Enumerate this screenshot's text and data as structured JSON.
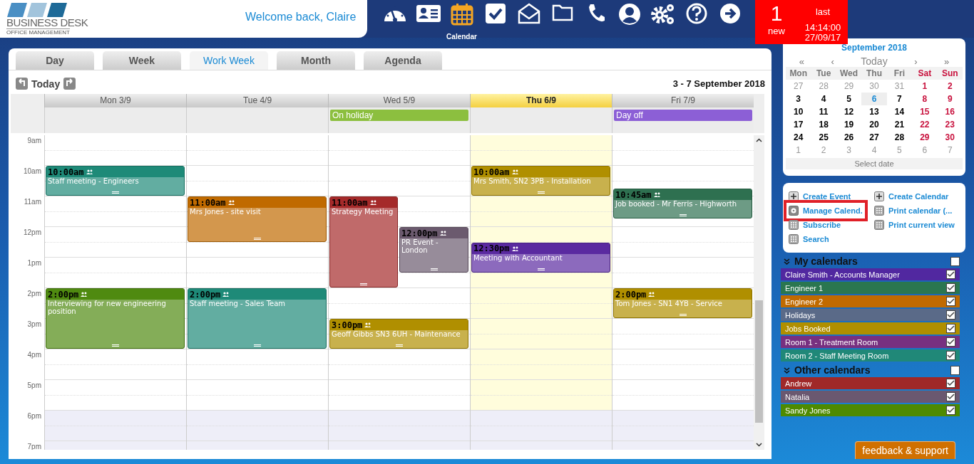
{
  "header": {
    "logo_title": "BUSINESS DESK",
    "logo_subtitle": "OFFICE MANAGEMENT",
    "welcome": "Welcome back, Claire"
  },
  "nav": [
    {
      "kind": "dashboard",
      "selected": false
    },
    {
      "kind": "contacts",
      "selected": false
    },
    {
      "kind": "calendar",
      "label": "Calendar",
      "selected": true
    },
    {
      "kind": "tasks",
      "selected": false
    },
    {
      "kind": "mail",
      "selected": false
    },
    {
      "kind": "folder",
      "selected": false
    },
    {
      "kind": "phone",
      "selected": false
    },
    {
      "kind": "user",
      "selected": false
    },
    {
      "kind": "settings",
      "selected": false
    },
    {
      "kind": "help",
      "selected": false
    },
    {
      "kind": "logout",
      "selected": false
    }
  ],
  "notification": {
    "count": "1",
    "count_label": "new",
    "last_label": "last",
    "time": "14:14:00",
    "date": "27/09/17"
  },
  "tabs": [
    {
      "label": "Day",
      "selected": false
    },
    {
      "label": "Week",
      "selected": false
    },
    {
      "label": "Work Week",
      "selected": true
    },
    {
      "label": "Month",
      "selected": false
    },
    {
      "label": "Agenda",
      "selected": false
    }
  ],
  "toolbar": {
    "today": "Today",
    "range": "3 - 7 September 2018"
  },
  "hours": [
    "9am",
    "10am",
    "11am",
    "12pm",
    "1pm",
    "2pm",
    "3pm",
    "4pm",
    "5pm",
    "6pm",
    "7pm"
  ],
  "days": [
    {
      "label": "Mon 3/9",
      "selected": false,
      "events": [
        {
          "time": "10:00am",
          "title": "Staff meeting - Engineers",
          "color": "#1e8a78",
          "kind": "hour"
        },
        {
          "time": "2:00pm",
          "title": "Interviewing for new engineering position",
          "color": "#4f8a10",
          "kind": "twohours"
        }
      ]
    },
    {
      "label": "Tue 4/9",
      "selected": false,
      "events": [
        {
          "time": "11:00am",
          "title": "Mrs Jones - site visit",
          "color": "#c06a00",
          "kind": "ninety"
        },
        {
          "time": "2:00pm",
          "title": "Staff meeting - Sales Team",
          "color": "#1e8a78",
          "kind": "twohours"
        }
      ]
    },
    {
      "label": "Wed 5/9",
      "selected": false,
      "all_day": [
        {
          "title": "On holiday",
          "color": "#8cbf3f"
        }
      ],
      "events": [
        {
          "time": "11:00am",
          "title": "Strategy Meeting",
          "color": "#a52a2a",
          "kind": "tallleft"
        },
        {
          "time": "12:00pm",
          "title": "PR Event - London",
          "color": "#6b5a6e",
          "kind": "ninetyright"
        },
        {
          "time": "3:00pm",
          "title": "Geoff Gibbs SN3 6UH - Maintenance",
          "color": "#b08f00",
          "kind": "hour"
        }
      ]
    },
    {
      "label": "Thu 6/9",
      "selected": true,
      "events": [
        {
          "time": "10:00am",
          "title": "Mrs Smith, SN2 3PB - Installation",
          "color": "#b08f00",
          "kind": "hour"
        },
        {
          "time": "12:30pm",
          "title": "Meeting with Accountant",
          "color": "#5a2aa0",
          "kind": "hour"
        }
      ]
    },
    {
      "label": "Fri 7/9",
      "selected": false,
      "all_day": [
        {
          "title": "Day off",
          "color": "#8c5fd6"
        }
      ],
      "events": [
        {
          "time": "10:45am",
          "title": "Job booked - Mr Ferris - Highworth",
          "color": "#2e7050",
          "kind": "hour"
        },
        {
          "time": "2:00pm",
          "title": "Tom Jones - SN1 4YB - Service",
          "color": "#b08f00",
          "kind": "hour"
        }
      ]
    }
  ],
  "mini_calendar": {
    "title": "September 2018",
    "prev_year": "«",
    "prev": "‹",
    "today": "Today",
    "next": "›",
    "next_year": "»",
    "weekdays": [
      "Mon",
      "Tue",
      "Wed",
      "Thu",
      "Fri",
      "Sat",
      "Sun"
    ],
    "weeks": [
      [
        {
          "d": "27",
          "outside": true,
          "selected": false
        },
        {
          "d": "28",
          "outside": true,
          "selected": false
        },
        {
          "d": "29",
          "outside": true,
          "selected": false
        },
        {
          "d": "30",
          "outside": true,
          "selected": false
        },
        {
          "d": "31",
          "outside": true,
          "selected": false
        },
        {
          "d": "1",
          "outside": false,
          "selected": false
        },
        {
          "d": "2",
          "outside": false,
          "selected": false
        }
      ],
      [
        {
          "d": "3",
          "outside": false,
          "selected": false
        },
        {
          "d": "4",
          "outside": false,
          "selected": false
        },
        {
          "d": "5",
          "outside": false,
          "selected": false
        },
        {
          "d": "6",
          "outside": false,
          "selected": true
        },
        {
          "d": "7",
          "outside": false,
          "selected": false
        },
        {
          "d": "8",
          "outside": false,
          "selected": false
        },
        {
          "d": "9",
          "outside": false,
          "selected": false
        }
      ],
      [
        {
          "d": "10",
          "outside": false,
          "selected": false
        },
        {
          "d": "11",
          "outside": false,
          "selected": false
        },
        {
          "d": "12",
          "outside": false,
          "selected": false
        },
        {
          "d": "13",
          "outside": false,
          "selected": false
        },
        {
          "d": "14",
          "outside": false,
          "selected": false
        },
        {
          "d": "15",
          "outside": false,
          "selected": false
        },
        {
          "d": "16",
          "outside": false,
          "selected": false
        }
      ],
      [
        {
          "d": "17",
          "outside": false,
          "selected": false
        },
        {
          "d": "18",
          "outside": false,
          "selected": false
        },
        {
          "d": "19",
          "outside": false,
          "selected": false
        },
        {
          "d": "20",
          "outside": false,
          "selected": false
        },
        {
          "d": "21",
          "outside": false,
          "selected": false
        },
        {
          "d": "22",
          "outside": false,
          "selected": false
        },
        {
          "d": "23",
          "outside": false,
          "selected": false
        }
      ],
      [
        {
          "d": "24",
          "outside": false,
          "selected": false
        },
        {
          "d": "25",
          "outside": false,
          "selected": false
        },
        {
          "d": "26",
          "outside": false,
          "selected": false
        },
        {
          "d": "27",
          "outside": false,
          "selected": false
        },
        {
          "d": "28",
          "outside": false,
          "selected": false
        },
        {
          "d": "29",
          "outside": false,
          "selected": false
        },
        {
          "d": "30",
          "outside": false,
          "selected": false
        }
      ],
      [
        {
          "d": "1",
          "outside": true,
          "selected": false
        },
        {
          "d": "2",
          "outside": true,
          "selected": false
        },
        {
          "d": "3",
          "outside": true,
          "selected": false
        },
        {
          "d": "4",
          "outside": true,
          "selected": false
        },
        {
          "d": "5",
          "outside": true,
          "selected": false
        },
        {
          "d": "6",
          "outside": true,
          "selected": false
        },
        {
          "d": "7",
          "outside": true,
          "selected": false
        }
      ]
    ],
    "footer": "Select date"
  },
  "actions": [
    {
      "label": "Create Event",
      "kind": "plus",
      "highlighted": false
    },
    {
      "label": "Create Calendar",
      "kind": "plus",
      "highlighted": false
    },
    {
      "label": "Manage Calend.",
      "kind": "gear",
      "highlighted": true
    },
    {
      "label": "Print calendar (...",
      "kind": "grid",
      "highlighted": false
    },
    {
      "label": "Subscribe",
      "kind": "grid",
      "highlighted": false
    },
    {
      "label": "Print current view",
      "kind": "grid",
      "highlighted": false
    },
    {
      "label": "Search",
      "kind": "grid",
      "highlighted": false
    }
  ],
  "calendar_groups": [
    {
      "title": "My calendars",
      "checked": false,
      "calendars": [
        {
          "name": "Claire Smith - Accounts Manager",
          "color": "#5128a0",
          "checked": true
        },
        {
          "name": "Engineer 1",
          "color": "#2a7650",
          "checked": true
        },
        {
          "name": "Engineer 2",
          "color": "#c06a00",
          "checked": true
        },
        {
          "name": "Holidays",
          "color": "#5a6a88",
          "checked": true
        },
        {
          "name": "Jobs Booked",
          "color": "#b08f00",
          "checked": true
        },
        {
          "name": "Room 1 - Treatment Room",
          "color": "#783080",
          "checked": true
        },
        {
          "name": "Room 2 - Staff Meeting Room",
          "color": "#208878",
          "checked": true
        }
      ]
    },
    {
      "title": "Other calendars",
      "checked": false,
      "calendars": [
        {
          "name": "Andrew",
          "color": "#a02828",
          "checked": true
        },
        {
          "name": "Natalia",
          "color": "#6a5870",
          "checked": true
        },
        {
          "name": "Sandy Jones",
          "color": "#4e8a00",
          "checked": true
        }
      ]
    }
  ],
  "feedback": "feedback & support"
}
